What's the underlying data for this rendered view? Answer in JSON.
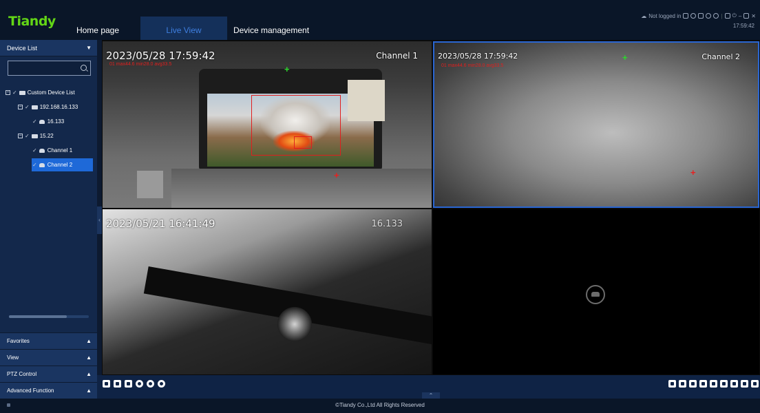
{
  "app": {
    "logo_text": "Tiandy",
    "brand_color": "#63d616"
  },
  "nav": {
    "tabs": [
      {
        "label": "Home page",
        "active": false
      },
      {
        "label": "Live View",
        "active": true
      },
      {
        "label": "Device management",
        "active": false
      }
    ]
  },
  "status": {
    "login_text": "Not logged in",
    "time": "17:59:42",
    "icons": [
      "cloud-icon",
      "keyboard-icon",
      "user-icon",
      "lock-screen-icon",
      "info-icon",
      "settings-icon",
      "lock-icon",
      "power-icon",
      "minimize-icon",
      "restore-icon",
      "close-icon"
    ]
  },
  "sidebar": {
    "device_list_label": "Device List",
    "search": {
      "value": "",
      "placeholder": ""
    },
    "tree": [
      {
        "label": "Custom Device List",
        "type": "folder",
        "level": 0,
        "expanded": true,
        "selected": false
      },
      {
        "label": "192.168.16.133",
        "type": "folder",
        "level": 1,
        "expanded": true,
        "selected": false
      },
      {
        "label": "16.133",
        "type": "camera",
        "level": 2,
        "selected": false
      },
      {
        "label": "15.22",
        "type": "folder",
        "level": 1,
        "expanded": true,
        "selected": false
      },
      {
        "label": "Channel 1",
        "type": "camera",
        "level": 2,
        "selected": false
      },
      {
        "label": "Channel 2",
        "type": "camera",
        "level": 2,
        "selected": true
      }
    ],
    "panels": [
      "Favorites",
      "View",
      "PTZ Control",
      "Advanced Function"
    ]
  },
  "videos": [
    {
      "timestamp": "2023/05/28 17:59:42",
      "channel": "Channel 1",
      "temp": "01 max44.6 min28.0 avg33.5"
    },
    {
      "timestamp": "2023/05/28 17:59:42",
      "channel": "Channel 2",
      "temp": "01 max44.6 min28.0 avg33.5"
    },
    {
      "timestamp": "2023/05/21 16:41:49",
      "channel": "16.133",
      "temp": ""
    },
    {
      "timestamp": "",
      "channel": "",
      "temp": ""
    }
  ],
  "toolbar": {
    "left_icons": [
      "snapshot-icon",
      "record-icon",
      "talk-icon",
      "ptz-icon",
      "zoom-in-icon",
      "close-all-icon"
    ],
    "right_icons": [
      "layout-1-icon",
      "layout-4-icon",
      "layout-6-icon",
      "layout-8-icon",
      "layout-9-icon",
      "layout-13-icon",
      "layout-16-icon",
      "layout-25-icon",
      "fullscreen-icon"
    ]
  },
  "footer": {
    "copyright": "©Tiandy Co.,Ltd All Rights Reserved"
  }
}
